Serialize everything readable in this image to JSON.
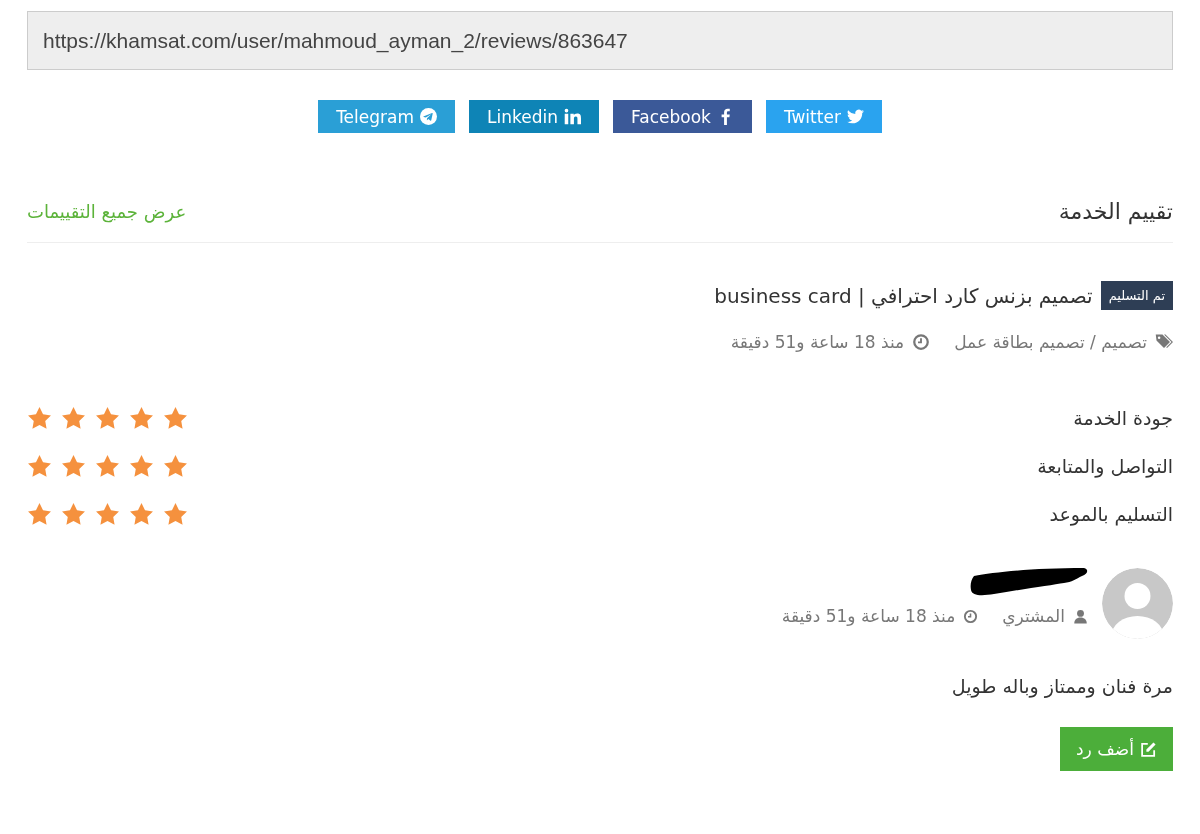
{
  "share_link": {
    "value": "https://khamsat.com/user/mahmoud_ayman_2/reviews/863647"
  },
  "share_buttons": [
    {
      "label": "Twitter",
      "kind": "twitter",
      "color": "#2aa3ef"
    },
    {
      "label": "Facebook",
      "kind": "facebook",
      "color": "#3b5998"
    },
    {
      "label": "Linkedin",
      "kind": "linkedin",
      "color": "#0e84b6"
    },
    {
      "label": "Telegram",
      "kind": "telegram",
      "color": "#2a9fd6"
    }
  ],
  "section": {
    "title": "تقييم الخدمة",
    "view_all_link": "عرض جميع التقييمات"
  },
  "service": {
    "status_badge": "تم التسليم",
    "title": "تصميم بزنس كارد احترافي | business card",
    "category": "تصميم / تصميم بطاقة عمل",
    "time": "منذ 18 ساعة و51 دقيقة"
  },
  "ratings": [
    {
      "label": "جودة الخدمة",
      "stars": 5
    },
    {
      "label": "التواصل والمتابعة",
      "stars": 5
    },
    {
      "label": "التسليم بالموعد",
      "stars": 5
    }
  ],
  "review": {
    "name_redacted": true,
    "role": "المشتري",
    "time": "منذ 18 ساعة و51 دقيقة",
    "comment": "مرة فنان وممتاز وباله طويل",
    "reply_button": "أضف رد"
  }
}
